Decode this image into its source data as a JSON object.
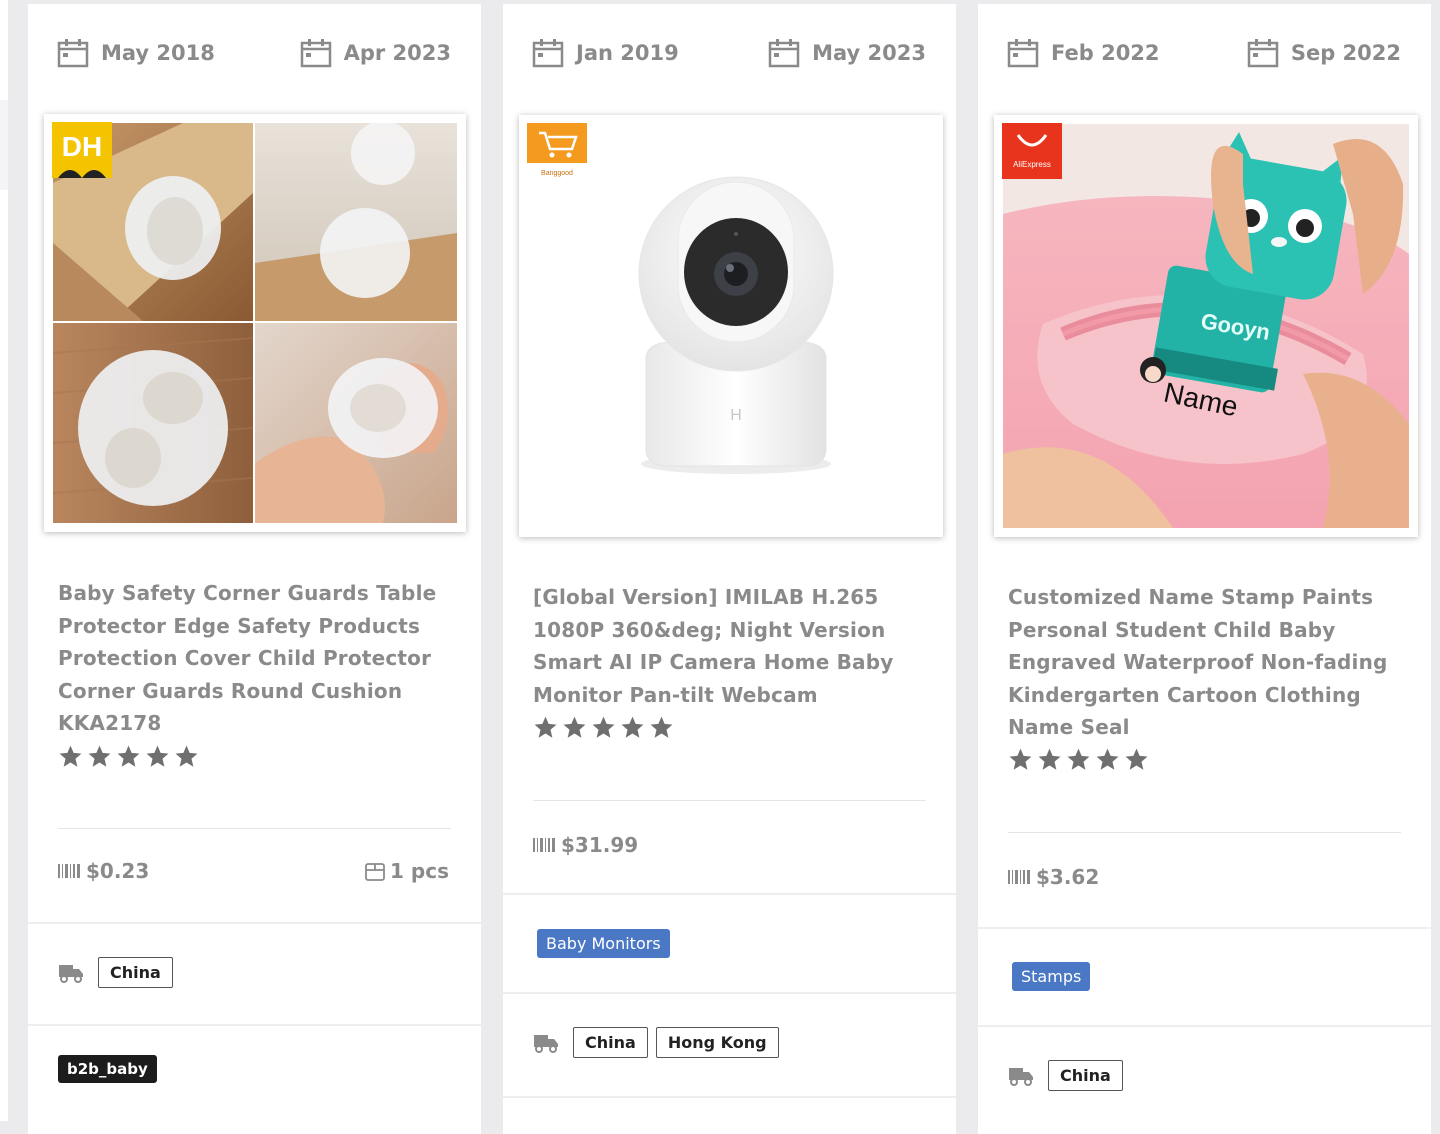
{
  "cards": [
    {
      "date_start": "May 2018",
      "date_end": "Apr 2023",
      "store_badge": "DH",
      "title": "Baby Safety Corner Guards Table Protector Edge Safety Products Protection Cover Child Protector Corner Guards Round Cushion KKA2178",
      "rating_stars": 5,
      "price": "$0.23",
      "quantity": "1 pcs",
      "ship_from": [
        "China"
      ],
      "source_tag": "b2b_baby"
    },
    {
      "date_start": "Jan 2019",
      "date_end": "May 2023",
      "store_badge": "Banggood",
      "title": "[Global Version] IMILAB H.265 1080P 360&deg; Night Version Smart AI IP Camera Home Baby Monitor Pan-tilt Webcam",
      "rating_stars": 5,
      "price": "$31.99",
      "category_tag": "Baby Monitors",
      "ship_from": [
        "China",
        "Hong Kong"
      ]
    },
    {
      "date_start": "Feb 2022",
      "date_end": "Sep 2022",
      "store_badge": "AliExpress",
      "title": "Customized Name Stamp Paints Personal Student Child Baby Engraved Waterproof Non-fading Kindergarten Cartoon Clothing Name Seal",
      "rating_stars": 5,
      "price": "$3.62",
      "category_tag": "Stamps",
      "ship_from": [
        "China"
      ],
      "image_text": {
        "brand": "Gooyn",
        "label": "Name"
      }
    }
  ],
  "icons": {
    "calendar": "calendar-icon",
    "barcode": "barcode-icon",
    "package": "package-icon",
    "truck": "truck-icon",
    "star": "star-icon"
  },
  "colors": {
    "text_gray": "#8a8a8a",
    "category_blue": "#4a78c4",
    "dh_yellow": "#f5c400",
    "banggood_orange": "#f39a1f",
    "aliexpress_red": "#e8331d"
  }
}
